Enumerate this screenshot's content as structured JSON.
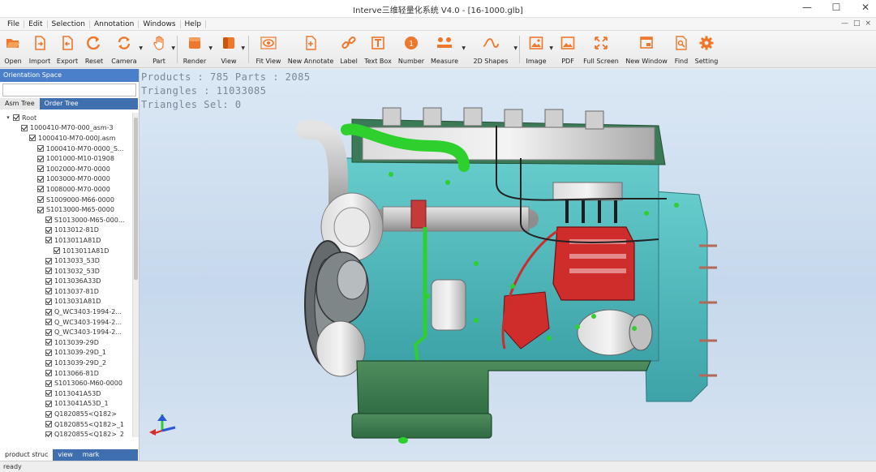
{
  "window": {
    "title": "Interve三维轻量化系统 V4.0 - [16-1000.glb]",
    "controls": [
      "—",
      "☐",
      "✕"
    ]
  },
  "menu": {
    "items": [
      "File",
      "Edit",
      "Selection",
      "Annotation",
      "Windows",
      "Help"
    ],
    "right": [
      "—",
      "□",
      "×"
    ]
  },
  "toolbar": {
    "buttons": [
      {
        "label": "Open",
        "icon": "folder-open-icon"
      },
      {
        "label": "Import",
        "icon": "import-icon"
      },
      {
        "label": "Export",
        "icon": "export-icon"
      },
      {
        "label": "Reset",
        "icon": "reset-icon"
      },
      {
        "label": "Camera",
        "icon": "camera-rotate-icon"
      },
      {
        "label": "Part",
        "icon": "hand-icon"
      },
      {
        "label": "Render",
        "icon": "render-cube-icon"
      },
      {
        "label": "View",
        "icon": "view-cube-icon"
      },
      {
        "label": "Fit View",
        "icon": "eye-icon"
      },
      {
        "label": "New Annotate",
        "icon": "annotate-icon"
      },
      {
        "label": "Label",
        "icon": "link-icon"
      },
      {
        "label": "Text Box",
        "icon": "text-box-icon"
      },
      {
        "label": "Number",
        "icon": "number-icon"
      },
      {
        "label": "Measure",
        "icon": "measure-icon"
      },
      {
        "label": "2D Shapes",
        "icon": "wave-icon"
      },
      {
        "label": "Image",
        "icon": "image-icon"
      },
      {
        "label": "PDF",
        "icon": "pdf-icon"
      },
      {
        "label": "Full Screen",
        "icon": "fullscreen-icon"
      },
      {
        "label": "New Window",
        "icon": "new-window-icon"
      },
      {
        "label": "Find",
        "icon": "find-icon"
      },
      {
        "label": "Setting",
        "icon": "gear-icon"
      }
    ]
  },
  "left_panel": {
    "header": "Orientation Space",
    "tabs": [
      "Asm Tree",
      "Order Tree"
    ],
    "active_tab": "Asm Tree",
    "tree": [
      {
        "label": "Root",
        "level": 0,
        "expander": "▾"
      },
      {
        "label": "1000410-M70-000_asm-3",
        "level": 1,
        "expander": ""
      },
      {
        "label": "1000410-M70-000J.asm",
        "level": 2,
        "expander": ""
      },
      {
        "label": "1000410-M70-0000_S...",
        "level": 3,
        "expander": ""
      },
      {
        "label": "1001000-M10-01908",
        "level": 3,
        "expander": ""
      },
      {
        "label": "1002000-M70-0000",
        "level": 3,
        "expander": ""
      },
      {
        "label": "1003000-M70-0000",
        "level": 3,
        "expander": ""
      },
      {
        "label": "1008000-M70-0000",
        "level": 3,
        "expander": ""
      },
      {
        "label": "S1009000-M66-0000",
        "level": 3,
        "expander": ""
      },
      {
        "label": "S1013000-M65-0000",
        "level": 3,
        "expander": ""
      },
      {
        "label": "S1013000-M65-000...",
        "level": 4,
        "expander": ""
      },
      {
        "label": "1013012-81D",
        "level": 4,
        "expander": ""
      },
      {
        "label": "1013011A81D",
        "level": 4,
        "expander": ""
      },
      {
        "label": "1013011A81D",
        "level": 5,
        "expander": ""
      },
      {
        "label": "1013033_53D",
        "level": 4,
        "expander": ""
      },
      {
        "label": "1013032_53D",
        "level": 4,
        "expander": ""
      },
      {
        "label": "1013036A33D",
        "level": 4,
        "expander": ""
      },
      {
        "label": "1013037-81D",
        "level": 4,
        "expander": ""
      },
      {
        "label": "1013031A81D",
        "level": 4,
        "expander": ""
      },
      {
        "label": "Q_WC3403-1994-2...",
        "level": 4,
        "expander": ""
      },
      {
        "label": "Q_WC3403-1994-2...",
        "level": 4,
        "expander": ""
      },
      {
        "label": "Q_WC3403-1994-2...",
        "level": 4,
        "expander": ""
      },
      {
        "label": "1013039-29D",
        "level": 4,
        "expander": ""
      },
      {
        "label": "1013039-29D_1",
        "level": 4,
        "expander": ""
      },
      {
        "label": "1013039-29D_2",
        "level": 4,
        "expander": ""
      },
      {
        "label": "1013066-81D",
        "level": 4,
        "expander": ""
      },
      {
        "label": "S1013060-M60-0000",
        "level": 4,
        "expander": ""
      },
      {
        "label": "1013041A53D",
        "level": 4,
        "expander": ""
      },
      {
        "label": "1013041A53D_1",
        "level": 4,
        "expander": ""
      },
      {
        "label": "Q1820855<Q182>",
        "level": 4,
        "expander": ""
      },
      {
        "label": "Q1820855<Q182>_1",
        "level": 4,
        "expander": ""
      },
      {
        "label": "Q1820855<Q182>_2",
        "level": 4,
        "expander": ""
      }
    ],
    "bottom_tabs": [
      "product struc",
      "view",
      "mark"
    ]
  },
  "viewport": {
    "stats": [
      "Products : 785  Parts : 2085",
      "Triangles : 11033085",
      "Triangles Sel: 0"
    ]
  },
  "status": {
    "text": "ready"
  },
  "colors": {
    "panel_blue": "#4a7fc9",
    "engine_block": "#5fc6c6",
    "engine_green": "#3c7a55",
    "highlight_green": "#3ee33e",
    "pump_red": "#d02a2a"
  }
}
